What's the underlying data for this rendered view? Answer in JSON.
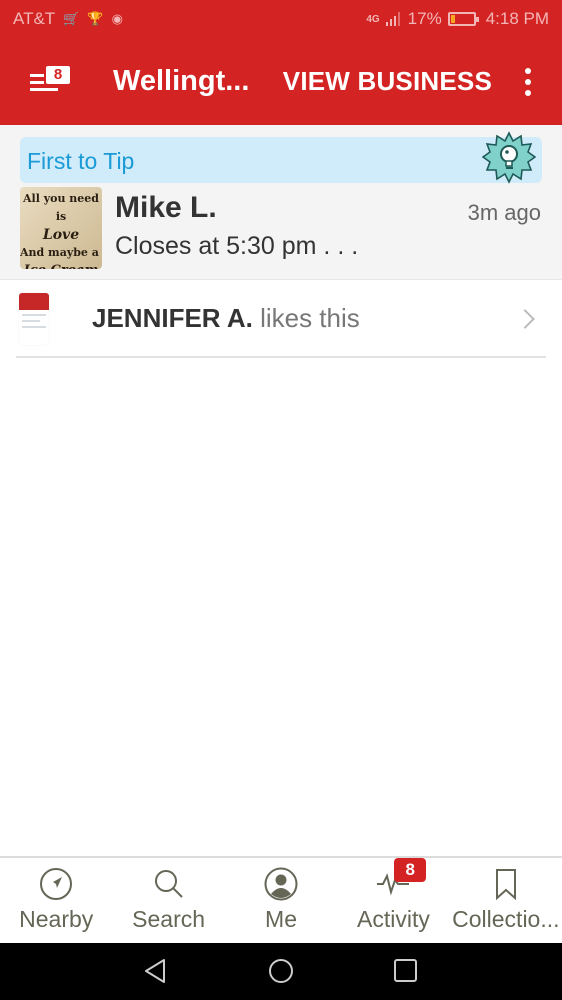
{
  "status_bar": {
    "carrier": "AT&T",
    "notification_icons": [
      "amazon-icon",
      "trophy-icon",
      "chrome-icon"
    ],
    "network": "4G",
    "battery_percent": "17%",
    "battery_level": 0.17,
    "time": "4:18 PM"
  },
  "app_bar": {
    "menu_badge": "8",
    "title": "Wellingt...",
    "action_label": "VIEW BUSINESS",
    "brand_color": "#d32323"
  },
  "tip": {
    "banner_label": "First to Tip",
    "badge_icon": "lightbulb-badge-icon",
    "thumbnail_lines": [
      "All you need is",
      "Love",
      "And maybe a little",
      "Ice Cream"
    ],
    "author": "Mike L.",
    "time": "3m ago",
    "text": "Closes at 5:30 pm . . ."
  },
  "like": {
    "name": "JENNIFER A.",
    "action": " likes this"
  },
  "bottom_nav": {
    "items": [
      {
        "label": "Nearby",
        "icon": "navigation-arrow-icon"
      },
      {
        "label": "Search",
        "icon": "search-icon"
      },
      {
        "label": "Me",
        "icon": "profile-icon"
      },
      {
        "label": "Activity",
        "icon": "activity-pulse-icon",
        "badge": "8"
      },
      {
        "label": "Collectio...",
        "icon": "bookmark-icon"
      }
    ]
  },
  "system_nav": [
    "back",
    "home",
    "recents"
  ]
}
